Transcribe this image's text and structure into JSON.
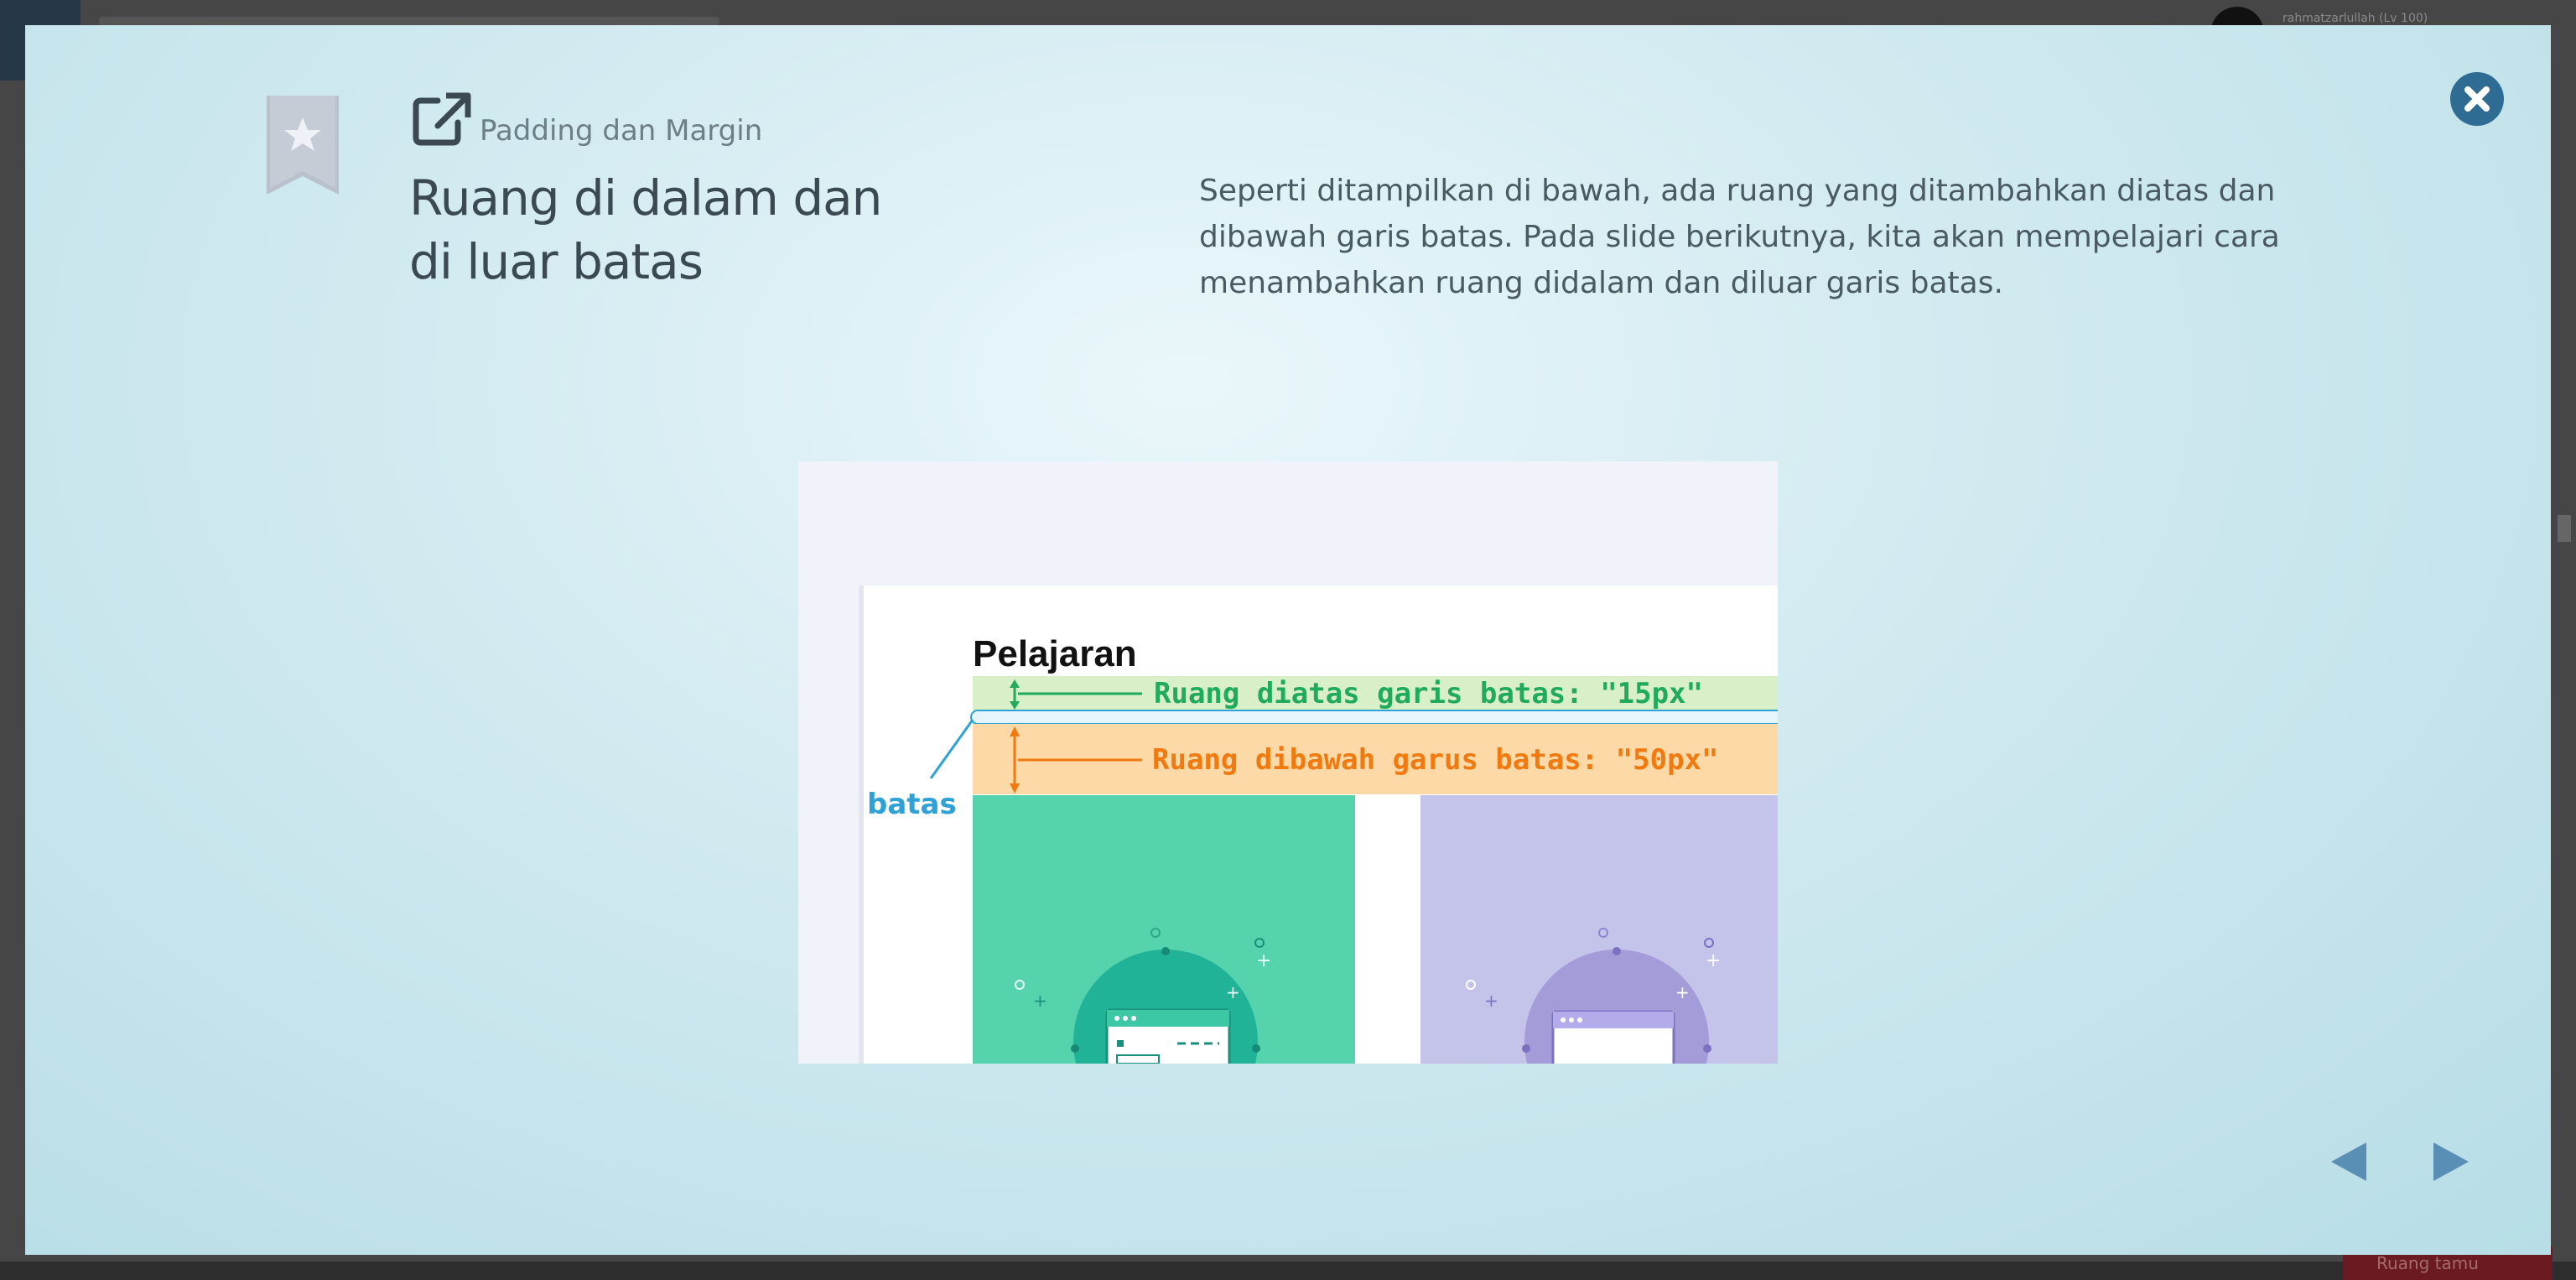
{
  "background": {
    "user_label": "rahmatzarlullah (Lv 100)",
    "action_button_label": "Ruang tamu"
  },
  "slide": {
    "section_title": "Padding dan Margin",
    "title_line1": "Ruang di dalam dan",
    "title_line2": "di luar batas",
    "description": "Seperti ditampilkan di bawah, ada ruang yang ditambahkan diatas dan dibawah garis batas. Pada slide berikutnya, kita akan mempelajari cara menambahkan ruang didalam dan diluar garis batas."
  },
  "illustration": {
    "heading": "Pelajaran",
    "label_above": "Ruang diatas garis batas: \"15px\"",
    "label_below": "Ruang dibawah garus batas: \"50px\"",
    "label_border": "batas"
  },
  "icons": {
    "bookmark": "bookmark-star-icon",
    "external": "external-link-icon",
    "close": "close-icon",
    "prev": "triangle-left-icon",
    "next": "triangle-right-icon"
  },
  "colors": {
    "modal_bg": "#d3ebf1",
    "accent": "#2f6c93",
    "green_band": "#d9efc7",
    "orange_band": "#fdd9a8",
    "teal_card": "#55d3ad",
    "purple_card": "#c4c3ea"
  }
}
